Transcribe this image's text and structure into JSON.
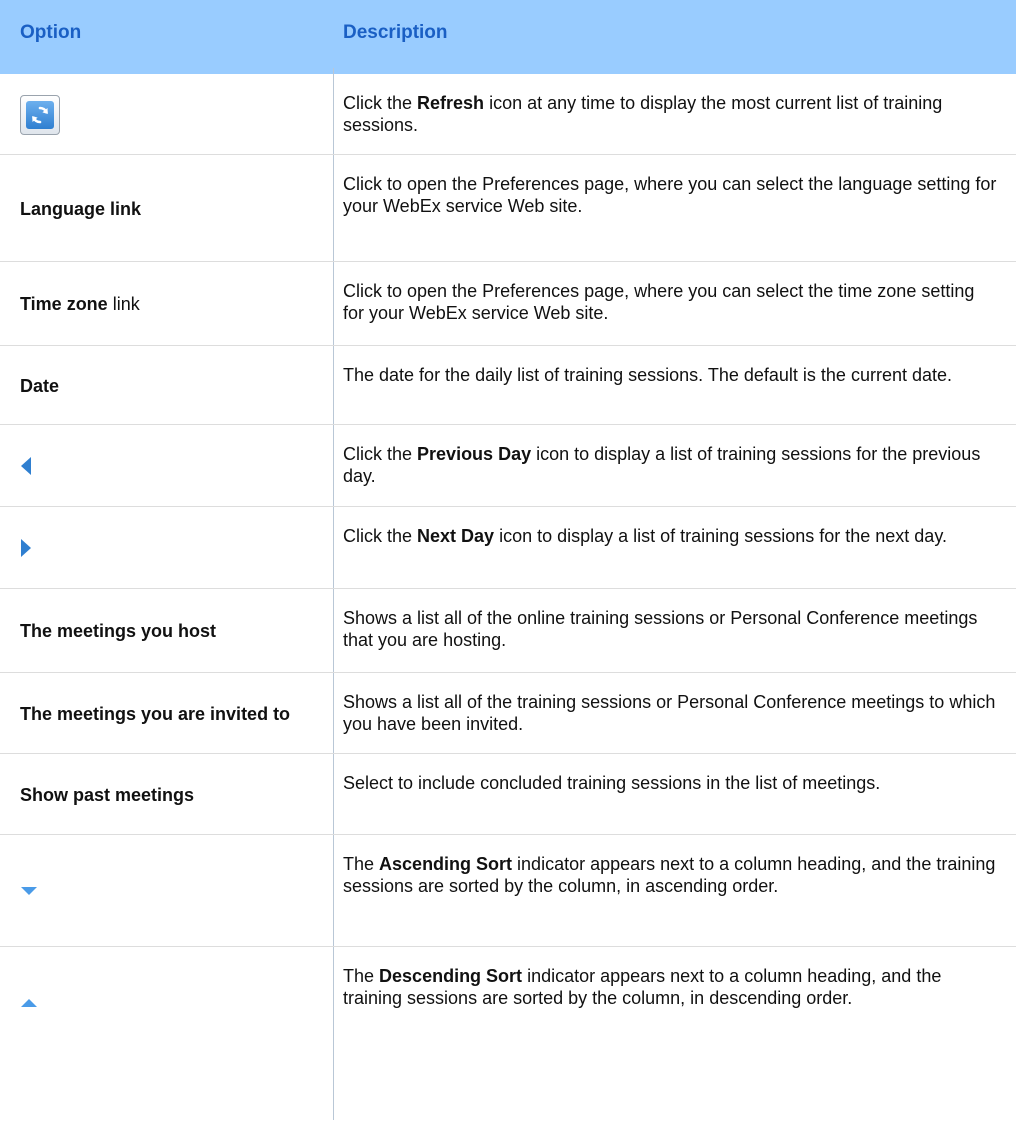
{
  "header": {
    "option": "Option",
    "description": "Description"
  },
  "rows": [
    {
      "option_icon": "refresh-icon",
      "desc": [
        {
          "t": "Click the "
        },
        {
          "b": "Refresh"
        },
        {
          "t": " icon at any time to display the most current list of training sessions."
        }
      ]
    },
    {
      "option": [
        {
          "b": "Language link"
        }
      ],
      "desc": [
        {
          "t": "Click to open the Preferences page, where you can select the language setting for your WebEx service Web site."
        }
      ]
    },
    {
      "option": [
        {
          "b": "Time zone"
        },
        {
          "t": " link"
        }
      ],
      "desc": [
        {
          "t": "Click to open the Preferences page, where you can select the time zone setting for your WebEx service Web site."
        }
      ]
    },
    {
      "option": [
        {
          "b": "Date"
        }
      ],
      "desc": [
        {
          "t": "The date for the daily list of training sessions. The default is the current date."
        }
      ]
    },
    {
      "option_icon": "previous-day-icon",
      "desc": [
        {
          "t": "Click the "
        },
        {
          "b": "Previous Day"
        },
        {
          "t": " icon to display a list of training sessions for the previous day."
        }
      ]
    },
    {
      "option_icon": "next-day-icon",
      "desc": [
        {
          "t": "Click the "
        },
        {
          "b": "Next Day"
        },
        {
          "t": " icon to display a list of training sessions for the next day."
        }
      ]
    },
    {
      "option": [
        {
          "b": "The meetings you host"
        }
      ],
      "desc": [
        {
          "t": "Shows a list all of the online training sessions or Personal Conference meetings that you are hosting."
        }
      ]
    },
    {
      "option": [
        {
          "b": "The meetings you are invited to"
        }
      ],
      "desc": [
        {
          "t": "Shows a list all of the training sessions or Personal Conference meetings to which you have been invited."
        }
      ]
    },
    {
      "option": [
        {
          "b": "Show past meetings"
        }
      ],
      "desc": [
        {
          "t": "Select to include concluded training sessions in the list of meetings."
        }
      ]
    },
    {
      "option_icon": "ascending-sort-icon",
      "desc": [
        {
          "t": "The "
        },
        {
          "b": "Ascending Sort"
        },
        {
          "t": " indicator appears next to a column heading, and the training sessions are sorted by the column, in ascending order."
        }
      ]
    },
    {
      "option_icon": "descending-sort-icon",
      "desc": [
        {
          "t": "The "
        },
        {
          "b": "Descending Sort"
        },
        {
          "t": " indicator appears next to a column heading, and the training sessions are sorted by the column, in descending order."
        }
      ]
    }
  ],
  "colors": {
    "header_bg": "#99ccff",
    "header_text": "#1a5fc4",
    "icon_blue": "#2f7fd0"
  }
}
